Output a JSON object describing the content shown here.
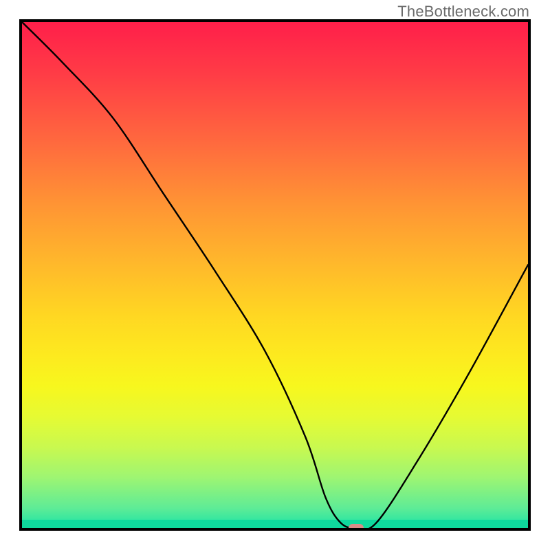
{
  "watermark": "TheBottleneck.com",
  "chart_data": {
    "type": "line",
    "title": "",
    "xlabel": "",
    "ylabel": "",
    "xlim": [
      0,
      100
    ],
    "ylim": [
      0,
      100
    ],
    "grid": false,
    "legend": false,
    "description": "V-shaped bottleneck curve over red-to-green vertical gradient background",
    "series": [
      {
        "name": "bottleneck-curve",
        "x": [
          0,
          8,
          18,
          28,
          38,
          48,
          56,
          60,
          63,
          66,
          70,
          78,
          88,
          100
        ],
        "y": [
          100,
          92,
          81,
          66,
          51,
          35,
          18,
          6,
          1,
          0,
          1,
          13,
          30,
          52
        ]
      }
    ],
    "marker": {
      "x": 66,
      "y": 0,
      "color": "#d98a87"
    },
    "gradient_stops": [
      {
        "pct": 0,
        "color": "#ff1f4a"
      },
      {
        "pct": 24,
        "color": "#ff6a3e"
      },
      {
        "pct": 48,
        "color": "#ffb92b"
      },
      {
        "pct": 72,
        "color": "#f7f71e"
      },
      {
        "pct": 90,
        "color": "#9ef572"
      },
      {
        "pct": 100,
        "color": "#19e3a6"
      }
    ]
  }
}
